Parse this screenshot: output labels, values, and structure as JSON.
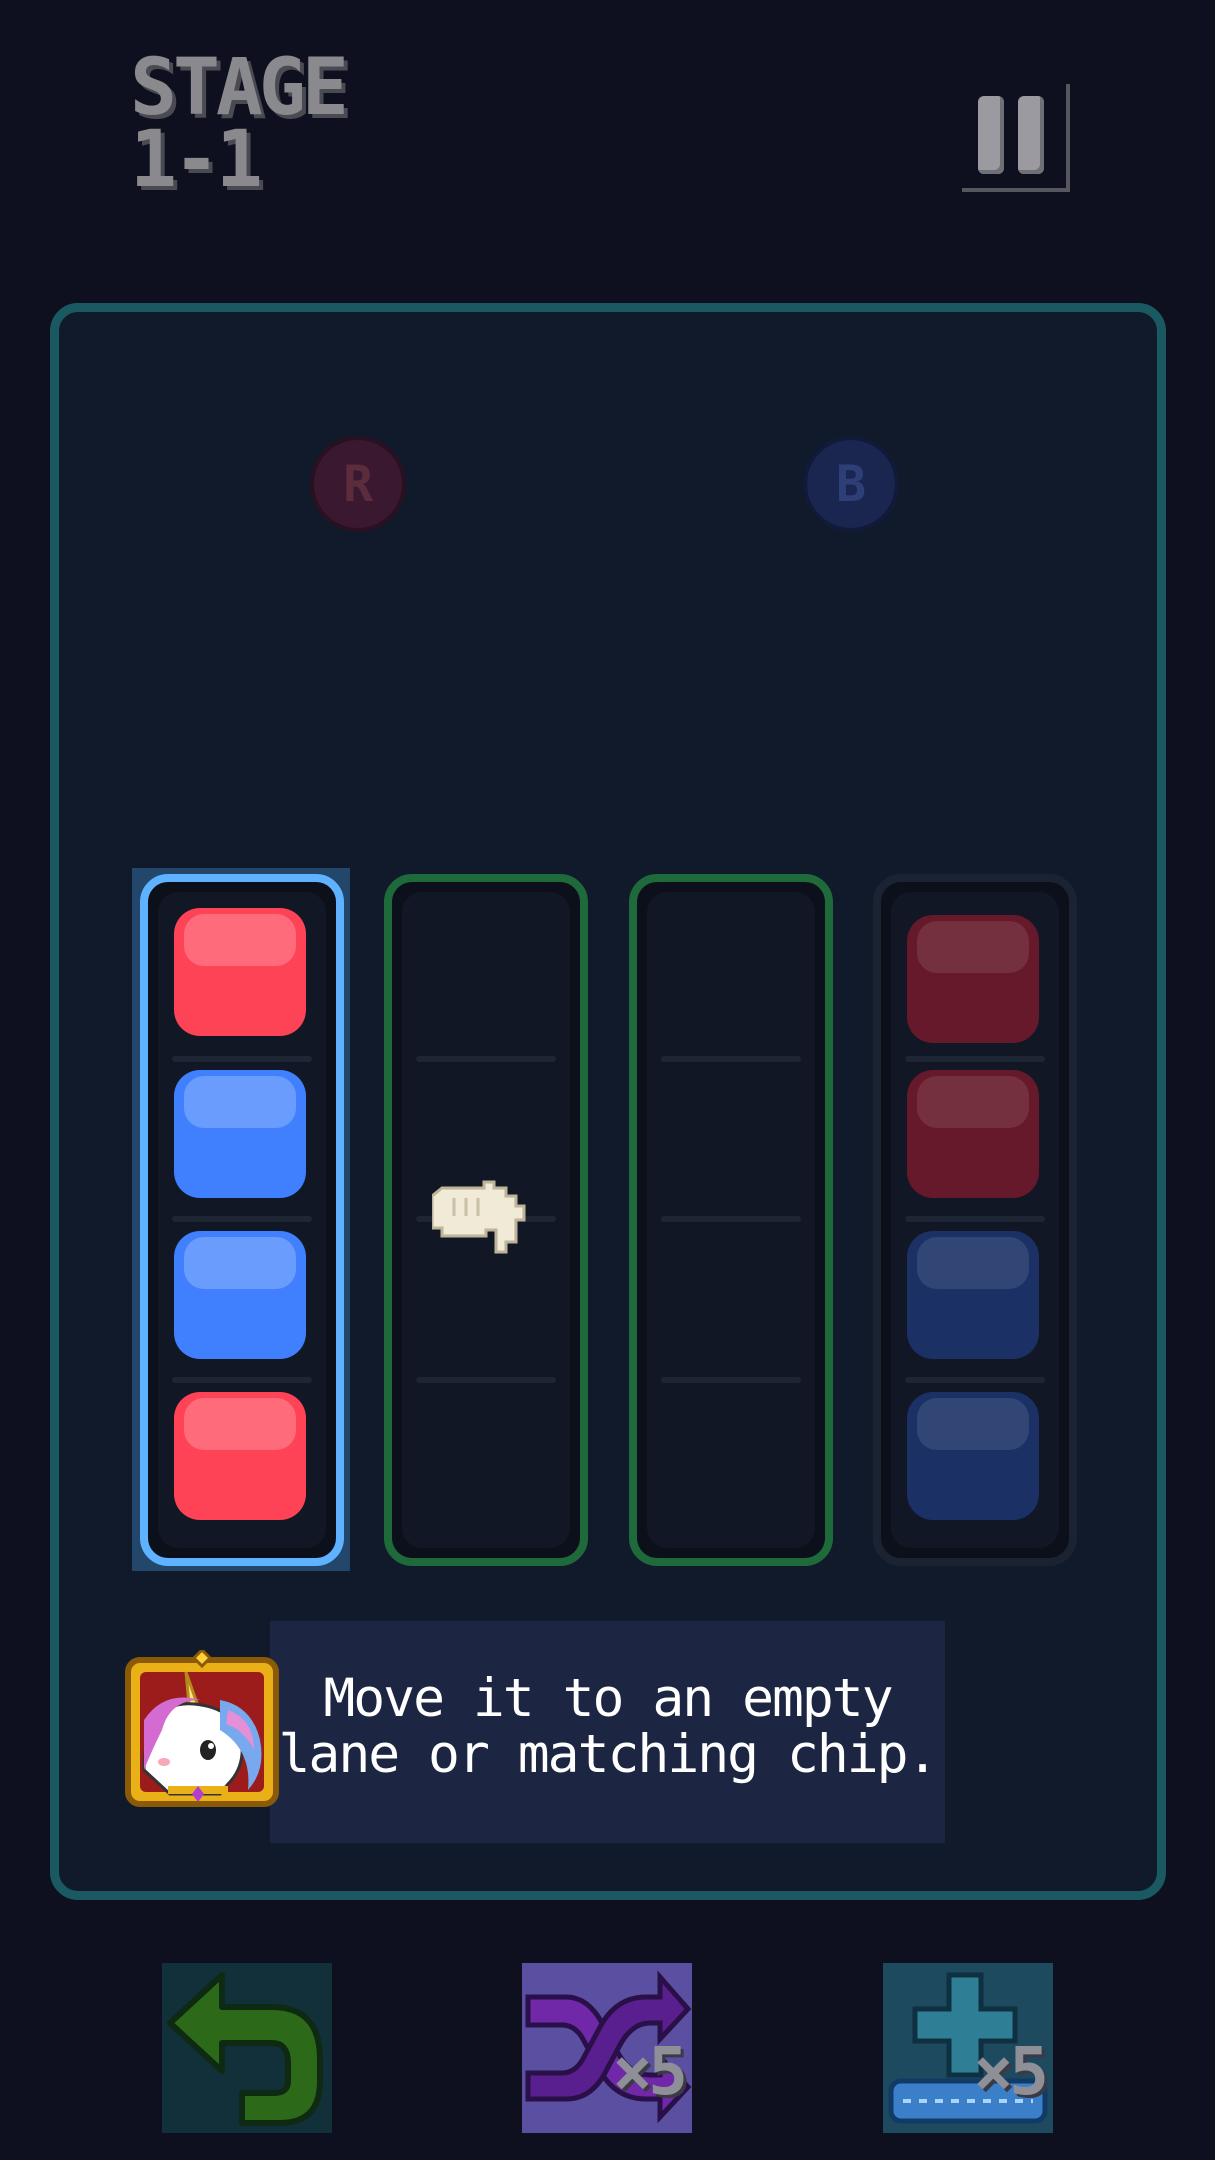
{
  "header": {
    "stage_line1": "STAGE",
    "stage_line2": "1-1"
  },
  "targets": {
    "red_label": "R",
    "blue_label": "B"
  },
  "lanes": [
    {
      "id": 1,
      "selected": true,
      "chips": [
        "red",
        "blue",
        "blue",
        "red"
      ]
    },
    {
      "id": 2,
      "selected": false,
      "chips": []
    },
    {
      "id": 3,
      "selected": false,
      "chips": []
    },
    {
      "id": 4,
      "selected": false,
      "chips": [
        "red-dim",
        "red-dim",
        "blue-dim",
        "blue-dim"
      ]
    }
  ],
  "hint": {
    "line1": "Move it to an empty",
    "line2": "lane or matching chip."
  },
  "tools": {
    "undo_icon": "undo-arrow-icon",
    "shuffle_count": "×5",
    "add_lane_count": "×5"
  },
  "colors": {
    "chip_red": "#fe4356",
    "chip_blue": "#4080fe",
    "selected_lane": "#5eb2ff",
    "valid_lane": "#1f6a3a",
    "board_border": "#1a5962"
  }
}
